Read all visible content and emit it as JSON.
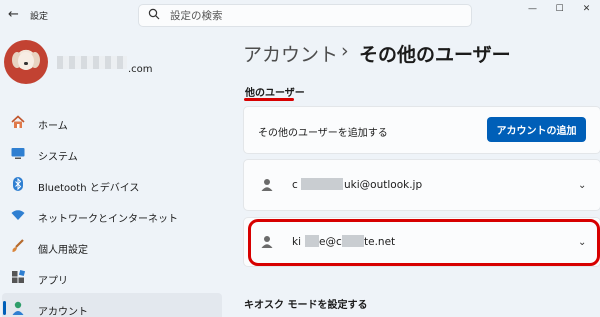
{
  "window": {
    "back_icon": "back-arrow-icon",
    "title": "設定",
    "controls": [
      "—",
      "☐",
      "✕"
    ]
  },
  "search": {
    "placeholder": "設定の検索"
  },
  "profile": {
    "email_suffix": ".com"
  },
  "sidebar": {
    "items": [
      {
        "label": "ホーム",
        "icon": "home-icon",
        "active": false
      },
      {
        "label": "システム",
        "icon": "system-icon",
        "active": false
      },
      {
        "label": "Bluetooth とデバイス",
        "icon": "bluetooth-icon",
        "active": false
      },
      {
        "label": "ネットワークとインターネット",
        "icon": "network-icon",
        "active": false
      },
      {
        "label": "個人用設定",
        "icon": "personalization-icon",
        "active": false
      },
      {
        "label": "アプリ",
        "icon": "apps-icon",
        "active": false
      },
      {
        "label": "アカウント",
        "icon": "accounts-icon",
        "active": true
      }
    ]
  },
  "breadcrumb": {
    "parent": "アカウント",
    "separator": "›",
    "current": "その他のユーザー"
  },
  "other_users": {
    "section_label": "他のユーザー",
    "add_text": "その他のユーザーを追加する",
    "add_button": "アカウントの追加",
    "accounts": [
      {
        "prefix": "c",
        "visible": "uki@outlook.jp"
      },
      {
        "prefix": "ki",
        "mid": "e@c",
        "visible": "te.net"
      }
    ]
  },
  "kiosk": {
    "label": "キオスク モードを設定する"
  },
  "colors": {
    "accent": "#005fb8",
    "annotation": "#d70000"
  }
}
